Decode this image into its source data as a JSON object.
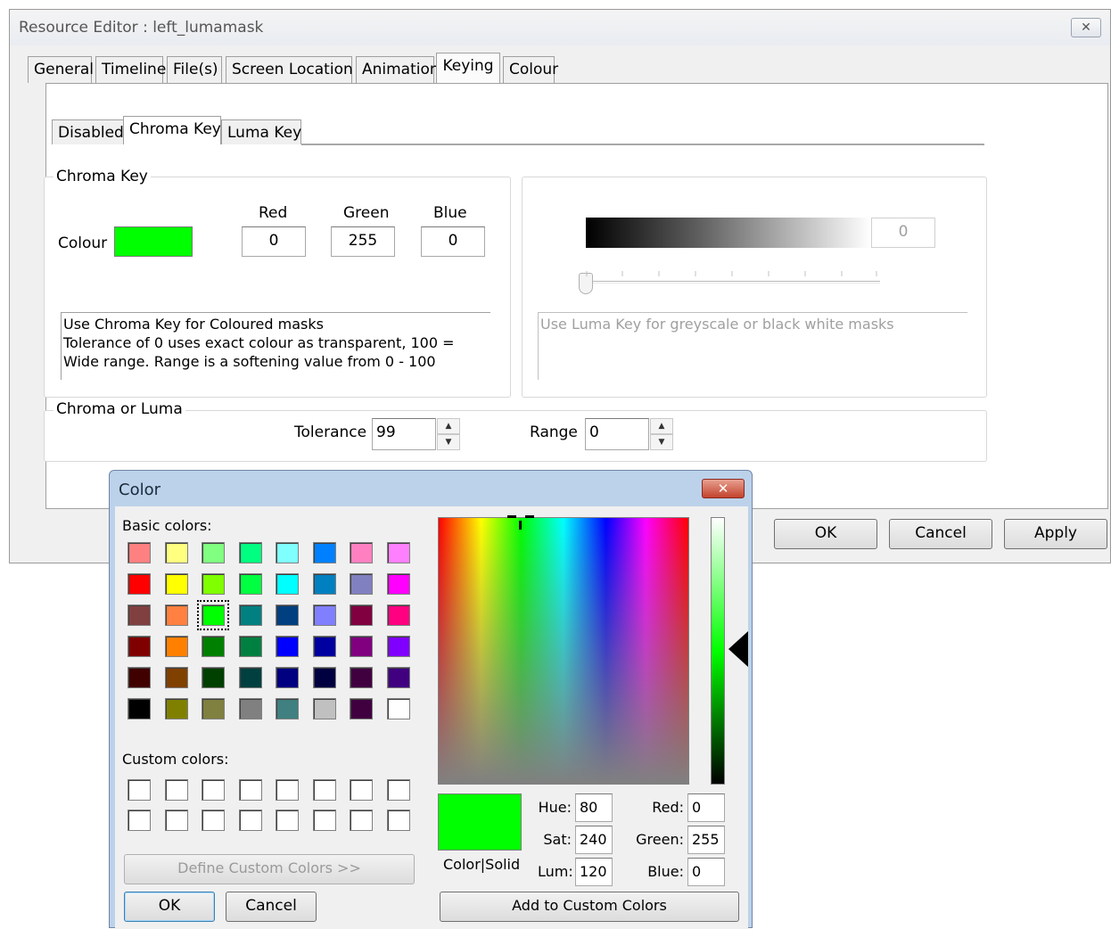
{
  "editor": {
    "title": "Resource Editor  :  left_lumamask",
    "close_glyph": "✕",
    "tabs": [
      "General",
      "Timeline",
      "File(s)",
      "Screen Location",
      "Animation",
      "Keying",
      "Colour"
    ],
    "active_tab": "Keying",
    "subtabs": [
      "Disabled",
      "Chroma Key",
      "Luma Key"
    ],
    "active_subtab": "Chroma Key",
    "chroma": {
      "group_label": "Chroma Key",
      "colour_label": "Colour",
      "colour_value": "#00ff00",
      "red_label": "Red",
      "green_label": "Green",
      "blue_label": "Blue",
      "red": "0",
      "green": "255",
      "blue": "0",
      "help_text": "Use Chroma Key for Coloured masks\nTolerance of 0 uses exact colour as transparent, 100 = Wide range. Range is a softening value from 0 - 100"
    },
    "luma": {
      "value": "0",
      "help_text": "Use Luma Key for greyscale or black white masks"
    },
    "chroma_or_luma": {
      "group_label": "Chroma or Luma",
      "tolerance_label": "Tolerance",
      "tolerance": "99",
      "range_label": "Range",
      "range": "0"
    },
    "buttons": {
      "ok": "OK",
      "cancel": "Cancel",
      "apply": "Apply"
    }
  },
  "color_dialog": {
    "title": "Color",
    "close_glyph": "✕",
    "basic_colors_label": "Basic colors:",
    "basic_colors": [
      [
        "#ff8080",
        "#ffff80",
        "#80ff80",
        "#00ff80",
        "#80ffff",
        "#0080ff",
        "#ff80c0",
        "#ff80ff"
      ],
      [
        "#ff0000",
        "#ffff00",
        "#80ff00",
        "#00ff40",
        "#00ffff",
        "#0080c0",
        "#8080c0",
        "#ff00ff"
      ],
      [
        "#804040",
        "#ff8040",
        "#00ff00",
        "#008080",
        "#004080",
        "#8080ff",
        "#800040",
        "#ff0080"
      ],
      [
        "#800000",
        "#ff8000",
        "#008000",
        "#008040",
        "#0000ff",
        "#0000a0",
        "#800080",
        "#8000ff"
      ],
      [
        "#400000",
        "#804000",
        "#004000",
        "#004040",
        "#000080",
        "#000040",
        "#400040",
        "#400080"
      ],
      [
        "#000000",
        "#808000",
        "#808040",
        "#808080",
        "#408080",
        "#c0c0c0",
        "#400040",
        "#ffffff"
      ]
    ],
    "selected_basic": "#00ff00",
    "custom_colors_label": "Custom colors:",
    "define_custom": "Define Custom Colors >>",
    "ok": "OK",
    "cancel": "Cancel",
    "color_solid_label": "Color|Solid",
    "preview_color": "#00ff00",
    "hue_label": "Hue:",
    "hue": "80",
    "sat_label": "Sat:",
    "sat": "240",
    "lum_label": "Lum:",
    "lum": "120",
    "red_label": "Red:",
    "red": "0",
    "green_label": "Green:",
    "green": "255",
    "blue_label": "Blue:",
    "blue": "0",
    "add_custom": "Add to Custom Colors"
  }
}
